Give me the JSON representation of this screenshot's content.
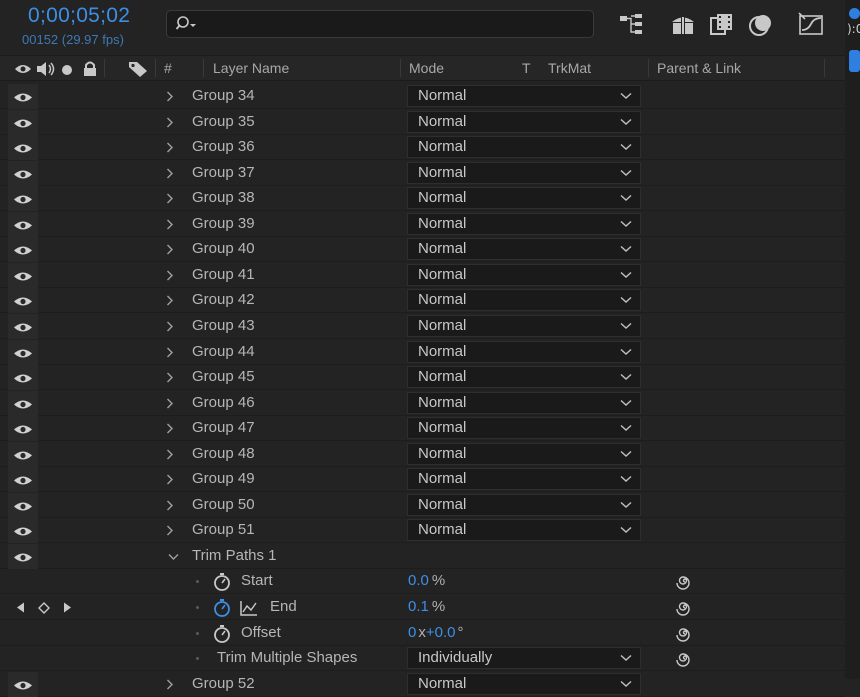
{
  "timecode": "0;00;05;02",
  "frames": "00152 (29.97 fps)",
  "search": {
    "placeholder": ""
  },
  "toolbar_icons": [
    "composition-flowchart-icon",
    "draft-3d-icon",
    "frame-blending-icon",
    "motion-blur-icon",
    "graph-editor-icon"
  ],
  "headers": {
    "number": "#",
    "layer_name": "Layer Name",
    "mode": "Mode",
    "t": "T",
    "trkmat": "TrkMat",
    "parent": "Parent & Link"
  },
  "groups": [
    {
      "name": "Group 34",
      "mode": "Normal"
    },
    {
      "name": "Group 35",
      "mode": "Normal"
    },
    {
      "name": "Group 36",
      "mode": "Normal"
    },
    {
      "name": "Group 37",
      "mode": "Normal"
    },
    {
      "name": "Group 38",
      "mode": "Normal"
    },
    {
      "name": "Group 39",
      "mode": "Normal"
    },
    {
      "name": "Group 40",
      "mode": "Normal"
    },
    {
      "name": "Group 41",
      "mode": "Normal"
    },
    {
      "name": "Group 42",
      "mode": "Normal"
    },
    {
      "name": "Group 43",
      "mode": "Normal"
    },
    {
      "name": "Group 44",
      "mode": "Normal"
    },
    {
      "name": "Group 45",
      "mode": "Normal"
    },
    {
      "name": "Group 46",
      "mode": "Normal"
    },
    {
      "name": "Group 47",
      "mode": "Normal"
    },
    {
      "name": "Group 48",
      "mode": "Normal"
    },
    {
      "name": "Group 49",
      "mode": "Normal"
    },
    {
      "name": "Group 50",
      "mode": "Normal"
    },
    {
      "name": "Group 51",
      "mode": "Normal"
    }
  ],
  "trim_paths": {
    "name": "Trim Paths 1",
    "start": {
      "label": "Start",
      "value": "0.0",
      "unit": "%"
    },
    "end": {
      "label": "End",
      "value": "0.1",
      "unit": "%"
    },
    "offset": {
      "label": "Offset",
      "revolutions": "0",
      "x": "x",
      "degrees": "+0.0",
      "unit": "°"
    },
    "trim_multiple": {
      "label": "Trim Multiple Shapes",
      "value": "Individually"
    }
  },
  "partial_row": {
    "name": "Group 52",
    "mode": "Normal"
  },
  "colors": {
    "accent": "#3d8fe6",
    "background": "#232323",
    "dropdown": "#1a1a1a"
  }
}
